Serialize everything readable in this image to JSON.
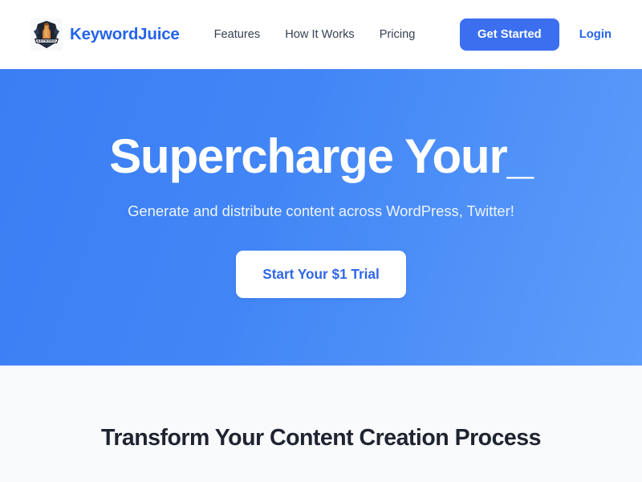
{
  "header": {
    "brand": {
      "name": "KeywordJuice",
      "logo_icon": "keyword-badge-logo"
    },
    "nav": [
      {
        "label": "Features"
      },
      {
        "label": "How It Works"
      },
      {
        "label": "Pricing"
      }
    ],
    "get_started_label": "Get Started",
    "login_label": "Login"
  },
  "hero": {
    "title": "Supercharge Your",
    "cursor": "_",
    "subtitle": "Generate and distribute content across WordPress, Twitter!",
    "cta_label": "Start Your $1 Trial"
  },
  "features": {
    "section_title": "Transform Your Content Creation Process"
  },
  "colors": {
    "brand_blue": "#2563eb",
    "button_blue": "#3b6ff0",
    "hero_gradient_start": "#3b7ef4",
    "hero_gradient_end": "#5c9cfa",
    "page_background": "#f8fafc",
    "heading_dark": "#1f2430",
    "nav_text": "#374151"
  }
}
